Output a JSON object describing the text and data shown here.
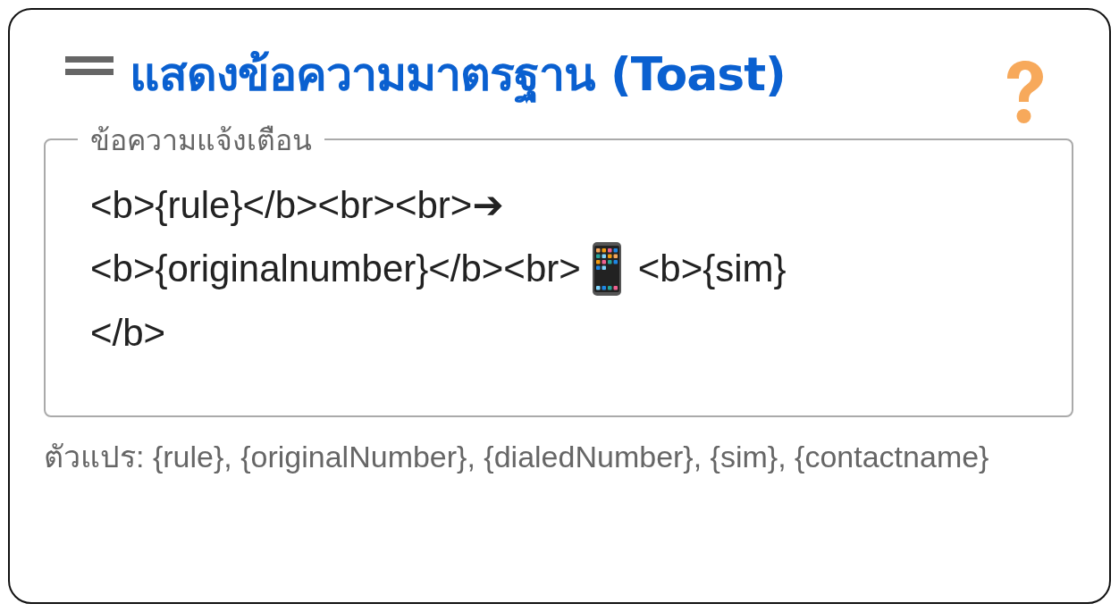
{
  "header": {
    "title": "แสดงข้อความมาตรฐาน (Toast)"
  },
  "field": {
    "label": "ข้อความแจ้งเตือน",
    "lines": [
      [
        {
          "kind": "text",
          "text": "<b>{rule}</b><br><br>➔"
        }
      ],
      [
        {
          "kind": "text",
          "text": "<b>{originalnumber}</b><br>"
        },
        {
          "kind": "phone"
        },
        {
          "kind": "text",
          "text": "<b>{sim}"
        }
      ],
      [
        {
          "kind": "text",
          "text": "</b>"
        }
      ]
    ]
  },
  "hint": "ตัวแปร: {rule}, {originalNumber}, {dialedNumber}, {sim}, {contactname}"
}
